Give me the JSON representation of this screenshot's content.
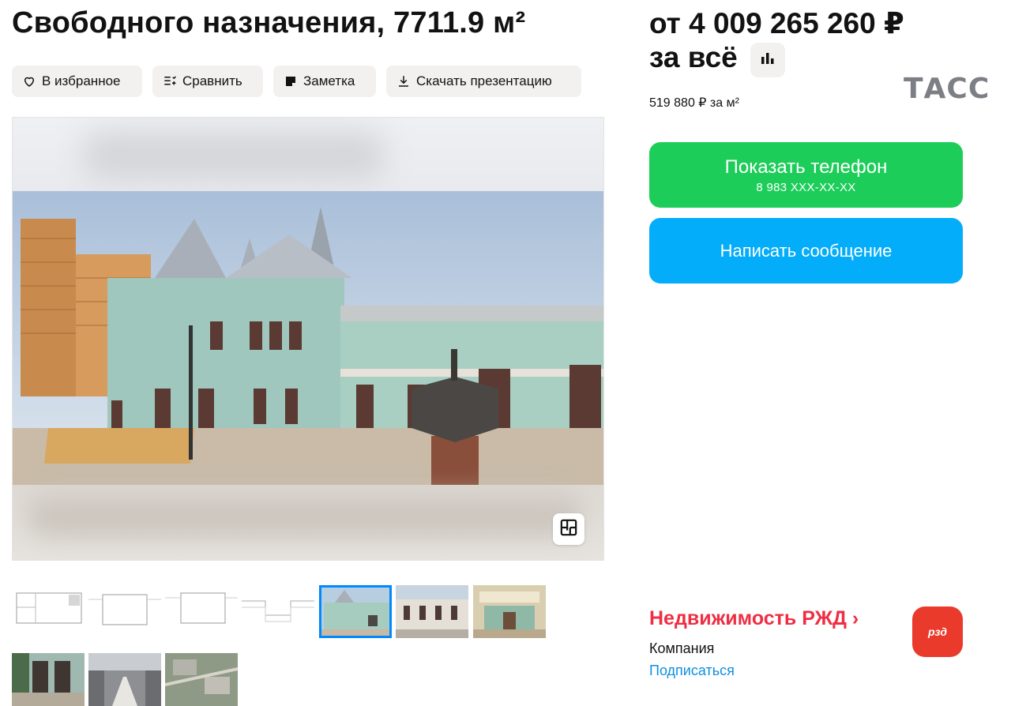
{
  "listing": {
    "title": "Свободного назначения, 7711.9 м²"
  },
  "actions": {
    "favorite": "В избранное",
    "compare": "Сравнить",
    "note": "Заметка",
    "download": "Скачать презентацию"
  },
  "gallery": {
    "main_photo_icon": "floor-plan-icon",
    "thumbnails": [
      {
        "kind": "floor-plan"
      },
      {
        "kind": "floor-plan"
      },
      {
        "kind": "floor-plan"
      },
      {
        "kind": "floor-plan"
      },
      {
        "kind": "photo-facade",
        "selected": true
      },
      {
        "kind": "photo-street"
      },
      {
        "kind": "photo-hall"
      },
      {
        "kind": "photo-arcade"
      },
      {
        "kind": "photo-conference"
      },
      {
        "kind": "photo-aerial"
      }
    ]
  },
  "price": {
    "line1": "от 4 009 265 260 ₽",
    "line2": "за всё",
    "per_m2": "519 880 ₽ за м²",
    "stats_icon": "bar-chart-icon"
  },
  "watermark": "ТАСС",
  "contact": {
    "show_phone": "Показать телефон",
    "phone_masked": "8 983 XXX-XX-XX",
    "write_message": "Написать сообщение"
  },
  "company": {
    "name": "Недвижимость РЖД ›",
    "type": "Компания",
    "subscribe": "Подписаться",
    "logo_text": "рзд"
  },
  "colors": {
    "phone_button": "#1dcd59",
    "message_button": "#04adf9",
    "company_name": "#ef2e43",
    "subscribe_link": "#0c8fe0",
    "logo_bg": "#ea3a2c",
    "thumb_selected": "#0088ff"
  }
}
